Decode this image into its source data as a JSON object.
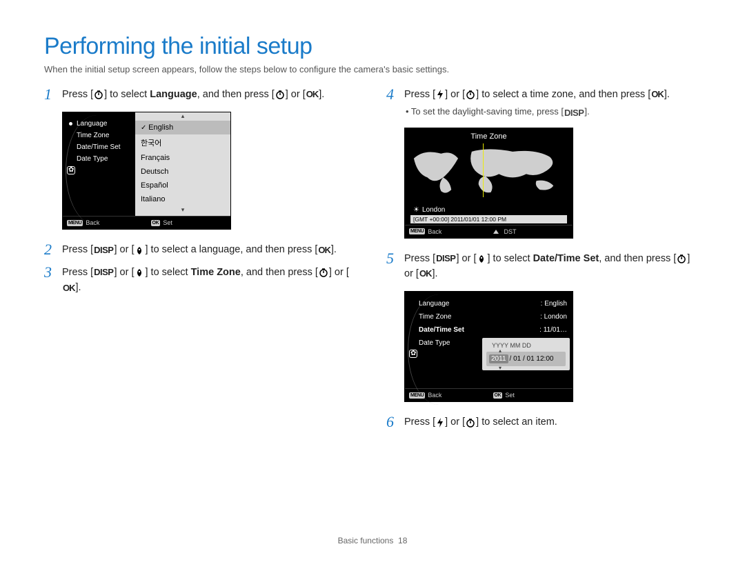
{
  "title": "Performing the initial setup",
  "subtitle": "When the initial setup screen appears, follow the steps below to configure the camera's basic settings.",
  "icons": {
    "disp": "DISP",
    "ok": "OK"
  },
  "steps": {
    "s1": {
      "num": "1",
      "pre": "Press [",
      "mid1": "] to select ",
      "bold": "Language",
      "mid2": ", and then press [",
      "mid3": "] or [",
      "end": "]."
    },
    "s2": {
      "num": "2",
      "pre": "Press [",
      "mid1": "] or [",
      "mid2": "] to select a language, and then press [",
      "end": "]."
    },
    "s3": {
      "num": "3",
      "pre": "Press [",
      "mid1": "] or [",
      "mid2": "] to select ",
      "bold": "Time Zone",
      "mid3": ", and then press [",
      "mid4": "] or [",
      "end": "]."
    },
    "s4": {
      "num": "4",
      "pre": "Press [",
      "mid1": "] or [",
      "mid2": "] to select a time zone, and then press [",
      "end": "]."
    },
    "s4note": {
      "pre": "•   To set the daylight-saving time, press [",
      "end": "]."
    },
    "s5": {
      "num": "5",
      "pre": "Press [",
      "mid1": "] or [",
      "mid2": "] to select ",
      "bold": "Date/Time Set",
      "mid3": ", and then press [",
      "mid4": "] or [",
      "end": "]."
    },
    "s6": {
      "num": "6",
      "pre": "Press [",
      "mid1": "] or [",
      "mid2": "] to select an item."
    }
  },
  "lcd1": {
    "menu": [
      "Language",
      "Time Zone",
      "Date/Time Set",
      "Date Type"
    ],
    "options": [
      "English",
      "한국어",
      "Français",
      "Deutsch",
      "Español",
      "Italiano"
    ],
    "footer_left_tag": "MENU",
    "footer_left": "Back",
    "footer_right_tag": "OK",
    "footer_right": "Set"
  },
  "lcd2": {
    "title": "Time Zone",
    "city": "London",
    "stamp": "[GMT +00:00] 2011/01/01 12:00 PM",
    "footer_left_tag": "MENU",
    "footer_left": "Back",
    "footer_right": "DST"
  },
  "lcd3": {
    "rows": [
      {
        "label": "Language",
        "value": ": English"
      },
      {
        "label": "Time Zone",
        "value": ": London"
      },
      {
        "label": "Date/Time Set",
        "value": ": 11/01…"
      },
      {
        "label": "Date Type",
        "value": ""
      }
    ],
    "box_label": "YYYY MM DD",
    "box_year": "2011",
    "box_rest": "/ 01 / 01 12:00",
    "footer_left_tag": "MENU",
    "footer_left": "Back",
    "footer_right_tag": "OK",
    "footer_right": "Set"
  },
  "footer": {
    "section": "Basic functions",
    "page": "18"
  }
}
